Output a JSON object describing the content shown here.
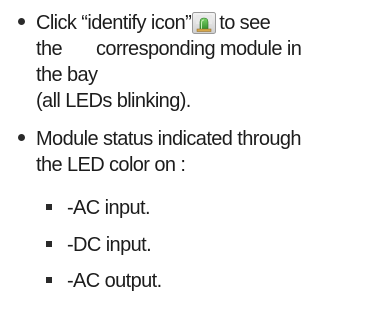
{
  "bullets": [
    {
      "line1_before_icon": "Click “identify icon”",
      "line1_after_icon": "to see",
      "line2_word1": "the",
      "line2_rest": "corresponding module in",
      "line3": "the bay",
      "line4": "(all LEDs blinking).",
      "icon": "identify-icon"
    },
    {
      "line1": "Module status indicated through",
      "line2": "the LED color on :"
    }
  ],
  "sub_items": [
    "-AC input.",
    "-DC input.",
    "-AC output."
  ]
}
